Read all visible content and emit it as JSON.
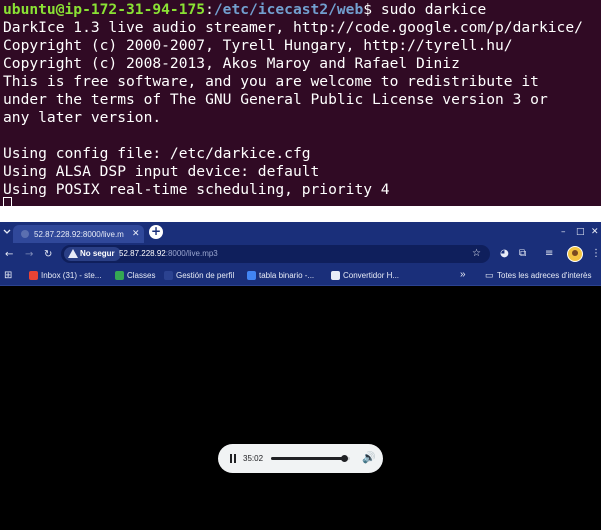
{
  "terminal": {
    "prompt_user": "ubuntu@ip-172-31-94-175",
    "prompt_sep": ":",
    "prompt_path": "/etc/icecast2/web",
    "prompt_symbol": "$",
    "command": " sudo darkice",
    "lines": [
      "DarkIce 1.3 live audio streamer, http://code.google.com/p/darkice/",
      "Copyright (c) 2000-2007, Tyrell Hungary, http://tyrell.hu/",
      "Copyright (c) 2008-2013, Akos Maroy and Rafael Diniz",
      "This is free software, and you are welcome to redistribute it",
      "under the terms of The GNU General Public License version 3 or",
      "any later version.",
      "",
      "Using config file: /etc/darkice.cfg",
      "Using ALSA DSP input device: default",
      "Using POSIX real-time scheduling, priority 4"
    ]
  },
  "browser": {
    "tab": {
      "title": "52.87.228.92:8000/live.m",
      "close_icon": "close-icon"
    },
    "new_tab_icon": "plus-icon",
    "window_controls": {
      "minimize": "–",
      "maximize": "□",
      "close": "✕"
    },
    "address": {
      "security_label": "No segur",
      "url_host": "52.87.228.92",
      "url_rest": ":8000/live.mp3"
    },
    "bookmarks": [
      {
        "label": "Inbox (31) - ste...",
        "icon": "gmail-icon",
        "color": "#ea4335"
      },
      {
        "label": "Classes",
        "icon": "classroom-icon",
        "color": "#34a853"
      },
      {
        "label": "Gestión de perfil",
        "icon": "globe-icon",
        "color": "#1a2f7a"
      },
      {
        "label": "tabla binario -...",
        "icon": "doc-icon",
        "color": "#4285f4"
      },
      {
        "label": "Convertidor H...",
        "icon": "rt-icon",
        "color": "#e8ecf7"
      }
    ],
    "bookmarks_overflow": "»",
    "other_bookmarks": "Totes les adreces d'interès"
  },
  "player": {
    "time": "35:02",
    "progress": 0.93
  },
  "colors": {
    "terminal_bg": "#300a24",
    "prompt_user": "#8ae234",
    "prompt_path": "#729fcf",
    "browser_frame": "#1a2f7a",
    "page_bg": "#000000",
    "player_bg": "#f1f3f4"
  }
}
